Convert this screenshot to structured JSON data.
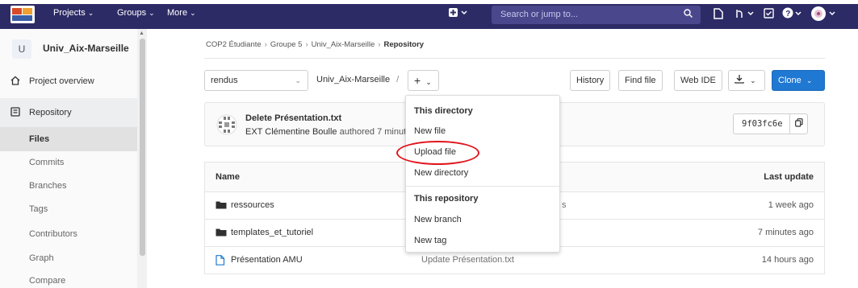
{
  "navbar": {
    "projects": "Projects",
    "groups": "Groups",
    "more": "More",
    "search_placeholder": "Search or jump to..."
  },
  "sidebar": {
    "avatar_letter": "U",
    "project_name": "Univ_Aix-Marseille",
    "items": [
      {
        "label": "Project overview"
      },
      {
        "label": "Repository"
      }
    ],
    "sub_items": [
      "Files",
      "Commits",
      "Branches",
      "Tags",
      "Contributors",
      "Graph",
      "Compare"
    ]
  },
  "breadcrumb": [
    "COP2 Étudiante",
    "Groupe 5",
    "Univ_Aix-Marseille",
    "Repository"
  ],
  "toolbar": {
    "branch": "rendus",
    "path": "Univ_Aix-Marseille",
    "path_sep": "/",
    "plus": "+",
    "history": "History",
    "find_file": "Find file",
    "web_ide": "Web IDE",
    "clone": "Clone"
  },
  "commit": {
    "title": "Delete Présentation.txt",
    "author": "EXT Clémentine Boulle",
    "meta": "authored 7 minut",
    "sha": "9f03fc6e"
  },
  "table": {
    "col_name": "Name",
    "col_update": "Last update",
    "rows": [
      {
        "name": "ressources",
        "type": "folder",
        "msg": "s",
        "time": "1 week ago"
      },
      {
        "name": "templates_et_tutoriel",
        "type": "folder",
        "msg": "",
        "time": "7 minutes ago"
      },
      {
        "name": "Présentation AMU",
        "type": "file",
        "msg": "Update Présentation.txt",
        "time": "14 hours ago"
      }
    ]
  },
  "dropdown": {
    "header_dir": "This directory",
    "new_file": "New file",
    "upload_file": "Upload file",
    "new_directory": "New directory",
    "header_repo": "This repository",
    "new_branch": "New branch",
    "new_tag": "New tag"
  },
  "colors": {
    "navbar": "#2d2b66",
    "accent": "#1f78d1",
    "highlight_ring": "#e0141c"
  }
}
